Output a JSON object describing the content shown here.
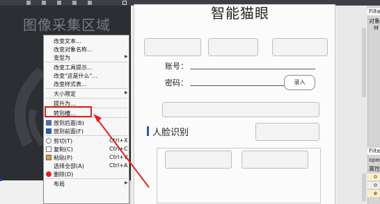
{
  "capture_area": {
    "title": "图像采集区域"
  },
  "form": {
    "title": "智能猫眼",
    "account_label": "账号：",
    "password_label": "密码：",
    "enter_button": "录入",
    "face_section": "人脸识别"
  },
  "context_menu": {
    "items": [
      {
        "label": "改变文本...",
        "shortcut": "",
        "submenu": false
      },
      {
        "label": "改变对象名称...",
        "shortcut": "",
        "submenu": false
      },
      {
        "label": "变型为",
        "shortcut": "",
        "submenu": true
      },
      {
        "label": "改变工具提示...",
        "shortcut": "",
        "submenu": false
      },
      {
        "label": "改变\"这是什么\"...",
        "shortcut": "",
        "submenu": false
      },
      {
        "label": "改变样式表...",
        "shortcut": "",
        "submenu": false
      },
      {
        "label": "大小限定",
        "shortcut": "",
        "submenu": true
      },
      {
        "label": "提升为...",
        "shortcut": "",
        "submenu": false
      },
      {
        "label": "转到槽...",
        "shortcut": "",
        "submenu": false
      },
      {
        "label": "放到后面(B)",
        "shortcut": "",
        "submenu": false
      },
      {
        "label": "放到前面(F)",
        "shortcut": "",
        "submenu": false
      },
      {
        "label": "剪切(T)",
        "shortcut": "Ctrl+X",
        "submenu": false
      },
      {
        "label": "复制(C)",
        "shortcut": "Ctrl+C",
        "submenu": false
      },
      {
        "label": "粘贴(P)",
        "shortcut": "Ctrl+V",
        "submenu": false
      },
      {
        "label": "选择全部(A)",
        "shortcut": "Ctrl+A",
        "submenu": false
      },
      {
        "label": "删除(D)",
        "shortcut": "",
        "submenu": false
      },
      {
        "label": "布局",
        "shortcut": "",
        "submenu": true
      }
    ],
    "highlighted_item": "转到槽..."
  },
  "right_panel": {
    "filter_top": "Filte",
    "object_label": "对象",
    "tree_row": "M",
    "filter_bottom": "Filte",
    "oper": "oper",
    "props_label": "属性",
    "row_a": "o",
    "row_b": "o",
    "row_c": "e"
  },
  "colors": {
    "annotation_red": "#e02020",
    "capture_bg": "#2b2e33",
    "accent_blue": "#2b57a6"
  }
}
